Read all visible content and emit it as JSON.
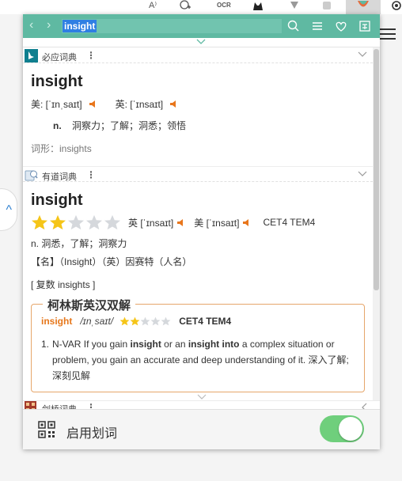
{
  "browser": {
    "read_aloud_icon": "A⁾",
    "ext_badge": "OCR"
  },
  "search": {
    "query": "insight"
  },
  "dictionaries": {
    "bing": {
      "name": "必应词典",
      "headword": "insight",
      "us_label": "美: [ˈɪnˌsaɪt]",
      "uk_label": "英: [ˈɪnsaɪt]",
      "pos": "n.",
      "definition": "洞察力；了解；洞悉；领悟",
      "forms": "词形：insights"
    },
    "youdao": {
      "name": "有道词典",
      "headword": "insight",
      "star_rating": 2,
      "star_max": 5,
      "uk_label": "英 [ˈɪnsaɪt]",
      "us_label": "美 [ˈɪnsaɪt]",
      "tags": "CET4 TEM4",
      "basic_def": "n. 洞悉，了解；洞察力",
      "name_def": "【名】（Insight）（英）因赛特（人名）",
      "plural": "[ 复数 insights ]",
      "collins": {
        "title": "柯林斯英汉双解",
        "word": "insight",
        "pron": "/ɪnˌsaɪt/",
        "star_rating": 2,
        "star_max": 5,
        "tags": "CET4 TEM4",
        "sense_num": "1.",
        "sense_prefix": "N-VAR If you gain ",
        "sense_bold1": "insight",
        "sense_mid": " or an ",
        "sense_bold2": "insight into",
        "sense_rest": " a complex situation or problem, you gain an accurate and deep understanding of it. 深入了解; 深刻见解"
      }
    },
    "cambridge": {
      "name": "剑桥词典"
    }
  },
  "footer": {
    "label": "启用划词",
    "toggle_on": true
  },
  "colors": {
    "topbar": "#5fb9a2",
    "accent_orange": "#e6771b",
    "star_filled": "#f5c518",
    "star_empty": "#d5d8dc",
    "toggle_on": "#6fcf7c"
  }
}
